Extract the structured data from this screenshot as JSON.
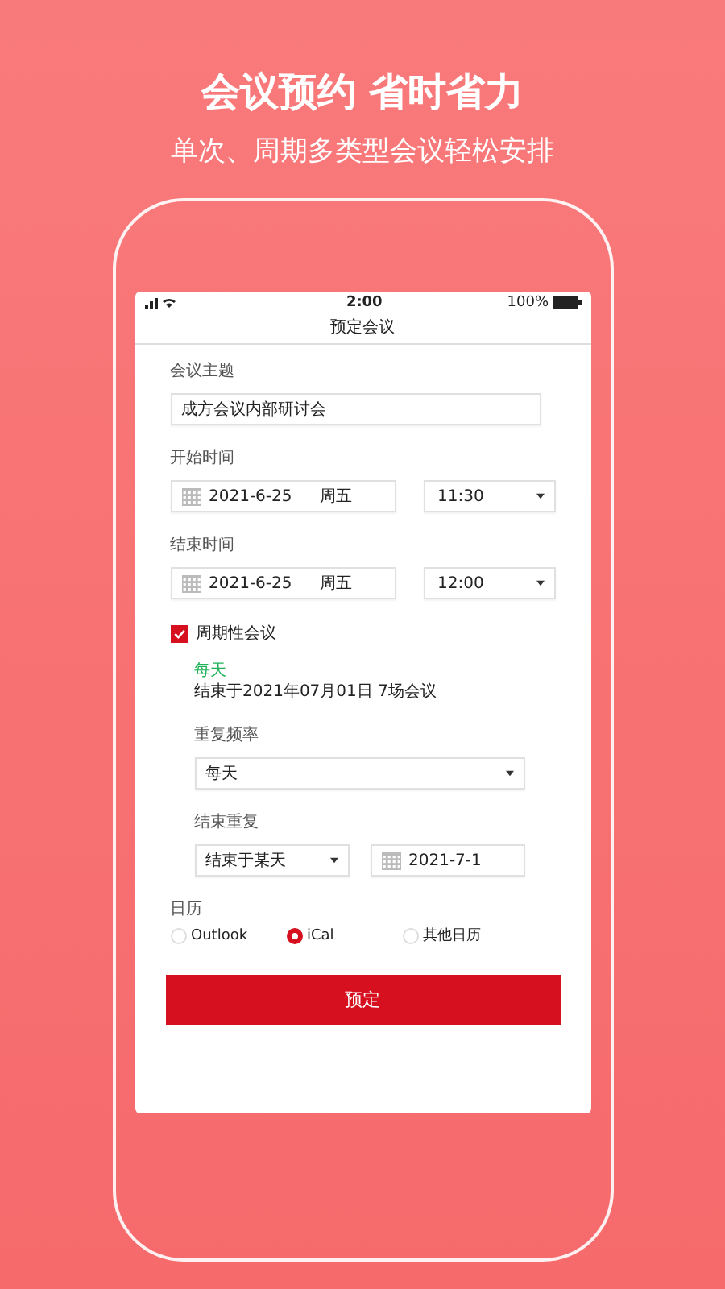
{
  "headline": "会议预约 省时省力",
  "subheadline": "单次、周期多类型会议轻松安排",
  "status_bar": {
    "time": "2:00",
    "battery": "100%"
  },
  "screen_title": "预定会议",
  "subject": {
    "label": "会议主题",
    "value": "成方会议内部研讨会"
  },
  "start": {
    "label": "开始时间",
    "date": "2021-6-25",
    "weekday": "周五",
    "time": "11:30"
  },
  "end": {
    "label": "结束时间",
    "date": "2021-6-25",
    "weekday": "周五",
    "time": "12:00"
  },
  "recurring": {
    "label": "周期性会议",
    "checked": true,
    "summary_frequency": "每天",
    "summary": "结束于2021年07月01日 7场会议",
    "frequency": {
      "label": "重复频率",
      "value": "每天"
    },
    "end_repeat": {
      "label": "结束重复",
      "mode": "结束于某天",
      "date": "2021-7-1"
    }
  },
  "calendar": {
    "label": "日历",
    "options": [
      {
        "label": "Outlook",
        "selected": false
      },
      {
        "label": "iCal",
        "selected": true
      },
      {
        "label": "其他日历",
        "selected": false
      }
    ]
  },
  "submit": "预定"
}
